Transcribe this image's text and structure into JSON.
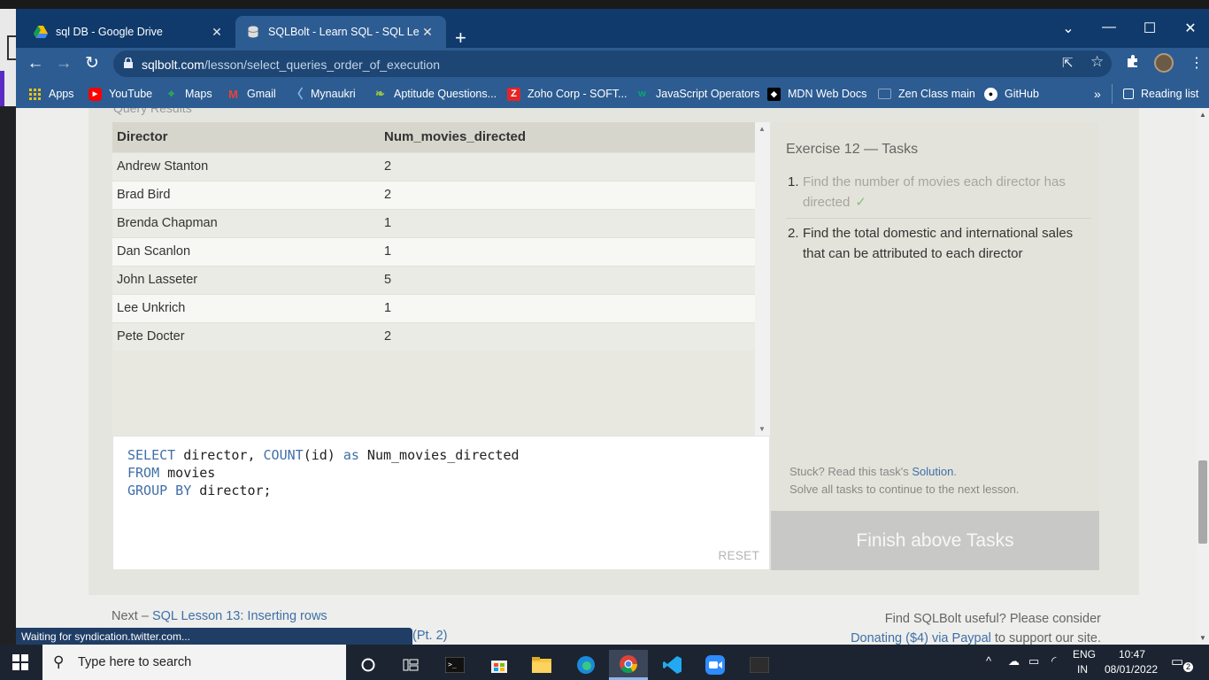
{
  "browser": {
    "tabs": [
      {
        "title": "sql DB - Google Drive",
        "icon": "google-drive-icon",
        "active": false
      },
      {
        "title": "SQLBolt - Learn SQL - SQL Lesson",
        "icon": "database-icon",
        "active": true
      }
    ],
    "url_host": "sqlbolt.com",
    "url_path": "/lesson/select_queries_order_of_execution",
    "reading_list": "Reading list",
    "bookmarks": [
      {
        "label": "Apps",
        "icon": "apps-grid-icon"
      },
      {
        "label": "YouTube",
        "icon": "youtube-icon"
      },
      {
        "label": "Maps",
        "icon": "maps-icon"
      },
      {
        "label": "Gmail",
        "icon": "gmail-icon"
      },
      {
        "label": "Mynaukri",
        "icon": "naukri-icon"
      },
      {
        "label": "Aptitude Questions...",
        "icon": "indiabix-icon"
      },
      {
        "label": "Zoho Corp - SOFT...",
        "icon": "zoho-icon"
      },
      {
        "label": "JavaScript Operators",
        "icon": "w3schools-icon"
      },
      {
        "label": "MDN Web Docs",
        "icon": "mdn-icon"
      },
      {
        "label": "Zen Class main",
        "icon": "zen-class-icon"
      },
      {
        "label": "GitHub",
        "icon": "github-icon"
      }
    ]
  },
  "page": {
    "query_results_label": "Query Results",
    "results": {
      "columns": [
        "Director",
        "Num_movies_directed"
      ],
      "rows": [
        [
          "Andrew Stanton",
          "2"
        ],
        [
          "Brad Bird",
          "2"
        ],
        [
          "Brenda Chapman",
          "1"
        ],
        [
          "Dan Scanlon",
          "1"
        ],
        [
          "John Lasseter",
          "5"
        ],
        [
          "Lee Unkrich",
          "1"
        ],
        [
          "Pete Docter",
          "2"
        ]
      ]
    },
    "editor": {
      "line1": {
        "kw1": "SELECT",
        "t1": " director, ",
        "kw2": "COUNT",
        "t2": "(id) ",
        "kw3": "as",
        "t3": " Num_movies_directed"
      },
      "line2": {
        "kw1": "FROM",
        "t1": " movies"
      },
      "line3": {
        "kw1": "GROUP BY",
        "t1": " director;"
      },
      "reset_label": "RESET"
    },
    "tasks": {
      "heading": "Exercise 12 — Tasks",
      "items": [
        {
          "num": "1.",
          "text": "Find the number of movies each director has directed",
          "done": true,
          "check": "✓"
        },
        {
          "num": "2.",
          "text": "Find the total domestic and international sales that can be attributed to each director",
          "done": false
        }
      ],
      "stuck_text": "Stuck? Read this task's ",
      "solution_link": "Solution",
      "stuck_end": ".",
      "continue_text": "Solve all tasks to continue to the next lesson.",
      "finish_button": "Finish above Tasks"
    },
    "footer": {
      "next_prefix": "Next – ",
      "next_link": "SQL Lesson 13: Inserting rows",
      "prev_fragment": "(Pt. 2)",
      "support_line1": "Find SQLBolt useful? Please consider",
      "support_link": "Donating ($4) via Paypal",
      "support_suffix": " to support our site."
    },
    "status_bubble": "Waiting for syndication.twitter.com..."
  },
  "taskbar": {
    "search_placeholder": "Type here to search",
    "lang1": "ENG",
    "lang2": "IN",
    "time": "10:47",
    "date": "08/01/2022",
    "notification_count": "2"
  }
}
